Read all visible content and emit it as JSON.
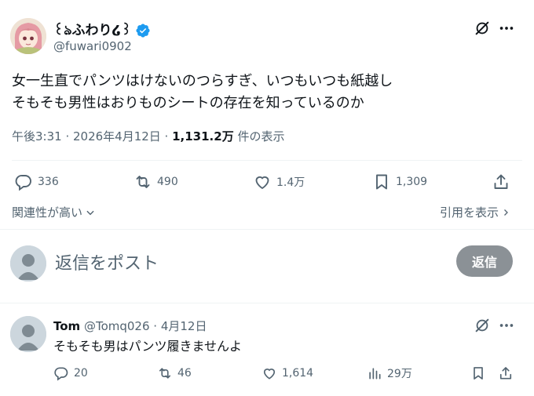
{
  "tweet": {
    "display_name": "꒰ঌふわり໒꒱",
    "handle": "@fuwari0902",
    "verified_color": "#1d9bf0",
    "text_lines": [
      "女一生直でパンツはけないのつらすぎ、いつもいつも紙越し",
      "そもそも男性はおりものシートの存在を知っているのか"
    ],
    "timestamp": "午後3:31 · 2026年4月12日 · ",
    "views_count": "1,131.2万",
    "views_label": " 件の表示",
    "replies": "336",
    "retweets": "490",
    "likes": "1.4万",
    "bookmarks": "1,309"
  },
  "links": {
    "relevance": "関連性が高い",
    "quotes": "引用を表示"
  },
  "composer": {
    "placeholder": "返信をポスト",
    "button": "返信"
  },
  "reply": {
    "name": "Tom",
    "handle": "@Tomq026",
    "date": " · 4月12日",
    "text": "そもそも男はパンツ履きませんよ",
    "replies": "20",
    "retweets": "46",
    "likes": "1,614",
    "views": "29万"
  }
}
